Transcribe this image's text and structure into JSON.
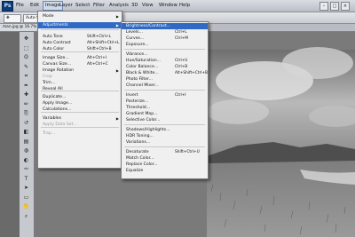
{
  "menubar": {
    "logo": "Ps",
    "items": [
      {
        "label": "File",
        "active": false
      },
      {
        "label": "Edit",
        "active": false
      },
      {
        "label": "Image",
        "active": true
      },
      {
        "label": "Layer",
        "active": false
      },
      {
        "label": "Select",
        "active": false
      },
      {
        "label": "Filter",
        "active": false
      },
      {
        "label": "Analysis",
        "active": false
      },
      {
        "label": "3D",
        "active": false
      },
      {
        "label": "View",
        "active": false
      },
      {
        "label": "Window",
        "active": false
      },
      {
        "label": "Help",
        "active": false
      }
    ]
  },
  "options_bar": {
    "field1": "Auto-Select:",
    "field2": "Layer"
  },
  "doc_tab": {
    "title": "man.jpg @ 16.7% (RGB/8)"
  },
  "image_menu": {
    "items": [
      {
        "label": "Mode",
        "shortcut": "",
        "submenu": true,
        "disabled": false
      },
      {
        "label": "Adjustments",
        "shortcut": "",
        "submenu": true,
        "disabled": false,
        "highlight": true
      },
      {
        "label": "Auto Tone",
        "shortcut": "Shift+Ctrl+L",
        "disabled": false
      },
      {
        "label": "Auto Contrast",
        "shortcut": "Alt+Shift+Ctrl+L",
        "disabled": false
      },
      {
        "label": "Auto Color",
        "shortcut": "Shift+Ctrl+B",
        "disabled": false
      },
      {
        "label": "Image Size...",
        "shortcut": "Alt+Ctrl+I",
        "disabled": false
      },
      {
        "label": "Canvas Size...",
        "shortcut": "Alt+Ctrl+C",
        "disabled": false
      },
      {
        "label": "Image Rotation",
        "shortcut": "",
        "submenu": true,
        "disabled": false
      },
      {
        "label": "Crop",
        "shortcut": "",
        "disabled": true
      },
      {
        "label": "Trim...",
        "shortcut": "",
        "disabled": false
      },
      {
        "label": "Reveal All",
        "shortcut": "",
        "disabled": false
      },
      {
        "label": "Duplicate...",
        "shortcut": "",
        "disabled": false
      },
      {
        "label": "Apply Image...",
        "shortcut": "",
        "disabled": false
      },
      {
        "label": "Calculations...",
        "shortcut": "",
        "disabled": false
      },
      {
        "label": "Variables",
        "shortcut": "",
        "submenu": true,
        "disabled": false
      },
      {
        "label": "Apply Data Set...",
        "shortcut": "",
        "disabled": true
      },
      {
        "label": "Trap...",
        "shortcut": "",
        "disabled": true
      }
    ]
  },
  "adjustments_menu": {
    "items": [
      {
        "label": "Brightness/Contrast...",
        "shortcut": "",
        "highlight": true
      },
      {
        "label": "Levels...",
        "shortcut": "Ctrl+L"
      },
      {
        "label": "Curves...",
        "shortcut": "Ctrl+M"
      },
      {
        "label": "Exposure...",
        "shortcut": ""
      },
      {
        "label": "Vibrance...",
        "shortcut": ""
      },
      {
        "label": "Hue/Saturation...",
        "shortcut": "Ctrl+U"
      },
      {
        "label": "Color Balance...",
        "shortcut": "Ctrl+B"
      },
      {
        "label": "Black & White...",
        "shortcut": "Alt+Shift+Ctrl+B"
      },
      {
        "label": "Photo Filter...",
        "shortcut": ""
      },
      {
        "label": "Channel Mixer...",
        "shortcut": ""
      },
      {
        "label": "Invert",
        "shortcut": "Ctrl+I"
      },
      {
        "label": "Posterize...",
        "shortcut": ""
      },
      {
        "label": "Threshold...",
        "shortcut": ""
      },
      {
        "label": "Gradient Map...",
        "shortcut": ""
      },
      {
        "label": "Selective Color...",
        "shortcut": ""
      },
      {
        "label": "Shadows/Highlights...",
        "shortcut": ""
      },
      {
        "label": "HDR Toning...",
        "shortcut": ""
      },
      {
        "label": "Variations...",
        "shortcut": ""
      },
      {
        "label": "Desaturate",
        "shortcut": "Shift+Ctrl+U"
      },
      {
        "label": "Match Color...",
        "shortcut": ""
      },
      {
        "label": "Replace Color...",
        "shortcut": ""
      },
      {
        "label": "Equalize",
        "shortcut": ""
      }
    ]
  },
  "tools": [
    "move-tool",
    "marquee-tool",
    "lasso-tool",
    "quick-select-tool",
    "crop-tool",
    "eyedropper-tool",
    "healing-tool",
    "brush-tool",
    "clone-tool",
    "history-brush-tool",
    "eraser-tool",
    "gradient-tool",
    "blur-tool",
    "dodge-tool",
    "pen-tool",
    "type-tool",
    "path-select-tool",
    "shape-tool",
    "hand-tool",
    "zoom-tool"
  ],
  "tool_glyphs": [
    "✥",
    "⬚",
    "ʘ",
    "✎",
    "⌗",
    "✒",
    "✚",
    "✏",
    "⎘",
    "↺",
    "◧",
    "▤",
    "◍",
    "◐",
    "✑",
    "T",
    "➤",
    "▭",
    "✋",
    "⌕"
  ],
  "colors": {
    "highlight": "#316ac5",
    "menu_bg": "#f0f0f0"
  }
}
